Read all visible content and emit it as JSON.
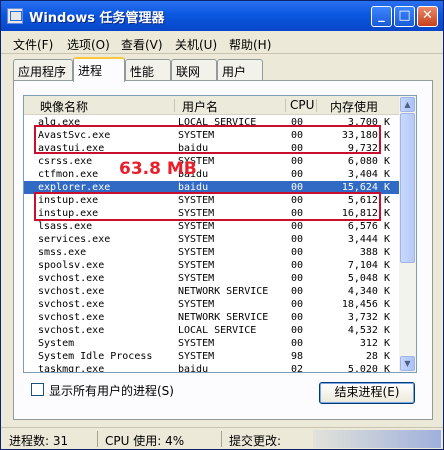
{
  "window": {
    "title": "Windows 任务管理器"
  },
  "title_buttons": {
    "minimize": "_",
    "maximize": "□",
    "close": "✕"
  },
  "menu": [
    "文件(F)",
    "选项(O)",
    "查看(V)",
    "关机(U)",
    "帮助(H)"
  ],
  "tabs": [
    "应用程序",
    "进程",
    "性能",
    "联网",
    "用户"
  ],
  "active_tab": "进程",
  "columns": {
    "name": "映像名称",
    "user": "用户名",
    "cpu": "CPU",
    "mem": "内存使用"
  },
  "processes": [
    {
      "name": "alg.exe",
      "user": "LOCAL SERVICE",
      "cpu": "00",
      "mem": "3,700 K"
    },
    {
      "name": "AvastSvc.exe",
      "user": "SYSTEM",
      "cpu": "00",
      "mem": "33,180 K"
    },
    {
      "name": "avastui.exe",
      "user": "baidu",
      "cpu": "00",
      "mem": "9,732 K"
    },
    {
      "name": "csrss.exe",
      "user": "SYSTEM",
      "cpu": "00",
      "mem": "6,080 K"
    },
    {
      "name": "ctfmon.exe",
      "user": "baidu",
      "cpu": "00",
      "mem": "3,404 K"
    },
    {
      "name": "explorer.exe",
      "user": "baidu",
      "cpu": "00",
      "mem": "15,624 K"
    },
    {
      "name": "instup.exe",
      "user": "SYSTEM",
      "cpu": "00",
      "mem": "5,612 K"
    },
    {
      "name": "instup.exe",
      "user": "SYSTEM",
      "cpu": "00",
      "mem": "16,812 K"
    },
    {
      "name": "lsass.exe",
      "user": "SYSTEM",
      "cpu": "00",
      "mem": "6,576 K"
    },
    {
      "name": "services.exe",
      "user": "SYSTEM",
      "cpu": "00",
      "mem": "3,444 K"
    },
    {
      "name": "smss.exe",
      "user": "SYSTEM",
      "cpu": "00",
      "mem": "388 K"
    },
    {
      "name": "spoolsv.exe",
      "user": "SYSTEM",
      "cpu": "00",
      "mem": "7,104 K"
    },
    {
      "name": "svchost.exe",
      "user": "SYSTEM",
      "cpu": "00",
      "mem": "5,048 K"
    },
    {
      "name": "svchost.exe",
      "user": "NETWORK SERVICE",
      "cpu": "00",
      "mem": "4,340 K"
    },
    {
      "name": "svchost.exe",
      "user": "SYSTEM",
      "cpu": "00",
      "mem": "18,456 K"
    },
    {
      "name": "svchost.exe",
      "user": "NETWORK SERVICE",
      "cpu": "00",
      "mem": "3,732 K"
    },
    {
      "name": "svchost.exe",
      "user": "LOCAL SERVICE",
      "cpu": "00",
      "mem": "4,532 K"
    },
    {
      "name": "System",
      "user": "SYSTEM",
      "cpu": "00",
      "mem": "312 K"
    },
    {
      "name": "System Idle Process",
      "user": "SYSTEM",
      "cpu": "98",
      "mem": "28 K"
    },
    {
      "name": "taskmgr.exe",
      "user": "baidu",
      "cpu": "02",
      "mem": "5,020 K"
    }
  ],
  "selected_row": 5,
  "annotation": "63.8 MB",
  "show_all_users_label": "显示所有用户的进程(S)",
  "end_process_label": "结束进程(E)",
  "status": {
    "processes": "进程数: 31",
    "cpu": "CPU 使用: 4%",
    "commit": "提交更改:"
  },
  "colors": {
    "title_bar": "#0a58e0",
    "selection": "#316ac5",
    "highlight_box": "#c8102e",
    "annotation": "#e8202c"
  }
}
